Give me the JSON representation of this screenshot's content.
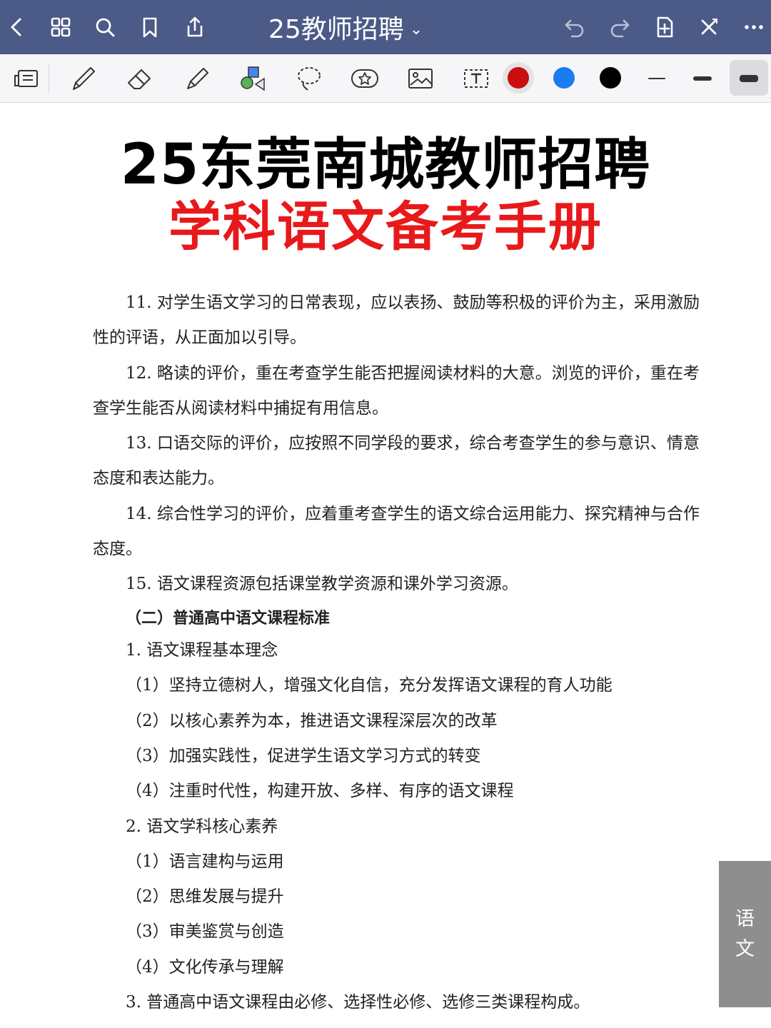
{
  "topbar": {
    "title": "25教师招聘",
    "title_chevron": "⌄",
    "color": "#4b5a86"
  },
  "toolbar": {
    "colors": [
      "#c80e0e",
      "#1a7cf0",
      "#000000"
    ],
    "selected_color": "#c80e0e"
  },
  "document": {
    "title_line1": "25东莞南城教师招聘",
    "title_line2": "学科语文备考手册",
    "title_line2_color": "#e8191b",
    "paragraphs": [
      "11. 对学生语文学习的日常表现，应以表扬、鼓励等积极的评价为主，采用激励性的评语，从正面加以引导。",
      "12. 略读的评价，重在考查学生能否把握阅读材料的大意。浏览的评价，重在考查学生能否从阅读材料中捕捉有用信息。",
      "13. 口语交际的评价，应按照不同学段的要求，综合考查学生的参与意识、情意态度和表达能力。",
      "14. 综合性学习的评价，应着重考查学生的语文综合运用能力、探究精神与合作态度。"
    ],
    "line_15": "15. 语文课程资源包括课堂教学资源和课外学习资源。",
    "section_heading": "（二）普通高中语文课程标准",
    "sub1_title": "1. 语文课程基本理念",
    "sub1_items": [
      "（1）坚持立德树人，增强文化自信，充分发挥语文课程的育人功能",
      "（2）以核心素养为本，推进语文课程深层次的改革",
      "（3）加强实践性，促进学生语文学习方式的转变",
      "（4）注重时代性，构建开放、多样、有序的语文课程"
    ],
    "sub2_title": "2. 语文学科核心素养",
    "sub2_items": [
      "（1）语言建构与运用",
      "（2）思维发展与提升",
      "（3）审美鉴赏与创造",
      "（4）文化传承与理解"
    ],
    "sub3_title": "3. 普通高中语文课程由必修、选择性必修、选修三类课程构成。"
  },
  "side_tab": {
    "char1": "语",
    "char2": "文"
  }
}
